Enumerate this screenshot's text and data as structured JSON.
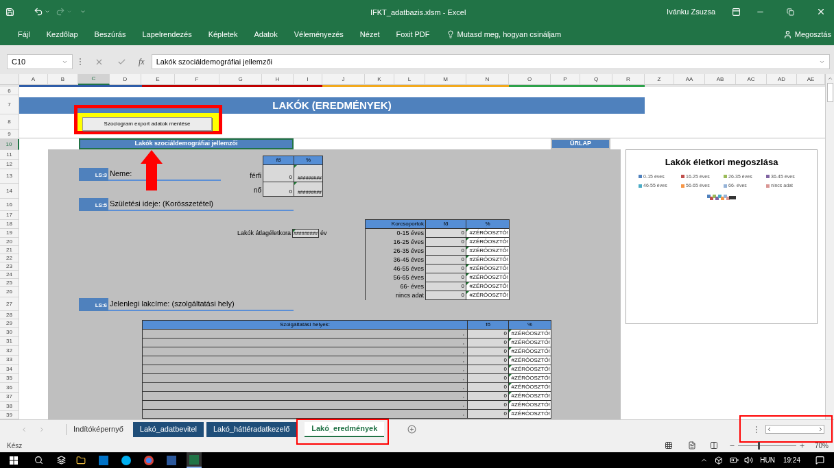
{
  "title_bar": {
    "title": "IFKT_adatbazis.xlsm - Excel",
    "user": "Ivánku Zsuzsa"
  },
  "ribbon_tabs": [
    "Fájl",
    "Kezdőlap",
    "Beszúrás",
    "Lapelrendezés",
    "Képletek",
    "Adatok",
    "Véleményezés",
    "Nézet",
    "Foxit PDF"
  ],
  "tell_me": "Mutasd meg, hogyan csináljam",
  "share": "Megosztás",
  "formula_bar": {
    "name_box": "C10",
    "fx": "fx",
    "value": "Lakók szociáldemográfiai jellemzői"
  },
  "column_headers": [
    {
      "label": "A",
      "selected": false
    },
    {
      "label": "B",
      "selected": false
    },
    {
      "label": "C",
      "selected": true
    },
    {
      "label": "D",
      "selected": false
    },
    {
      "label": "E",
      "selected": false
    },
    {
      "label": "F",
      "selected": false
    },
    {
      "label": "G",
      "selected": false
    },
    {
      "label": "H",
      "selected": false
    },
    {
      "label": "I",
      "selected": false
    },
    {
      "label": "J",
      "selected": false
    },
    {
      "label": "K",
      "selected": false
    },
    {
      "label": "L",
      "selected": false
    },
    {
      "label": "M",
      "selected": false
    },
    {
      "label": "N",
      "selected": false
    },
    {
      "label": "O",
      "selected": false
    },
    {
      "label": "P",
      "selected": false
    },
    {
      "label": "Q",
      "selected": false
    },
    {
      "label": "R",
      "selected": false
    },
    {
      "label": "Z",
      "selected": false
    },
    {
      "label": "AA",
      "selected": false
    },
    {
      "label": "AB",
      "selected": false
    },
    {
      "label": "AC",
      "selected": false
    },
    {
      "label": "AD",
      "selected": false
    },
    {
      "label": "AE",
      "selected": false
    }
  ],
  "row_headers": [
    {
      "label": "6",
      "selected": false
    },
    {
      "label": "7",
      "selected": false
    },
    {
      "label": "8",
      "selected": false
    },
    {
      "label": "9",
      "selected": false
    },
    {
      "label": "10",
      "selected": true
    },
    {
      "label": "11",
      "selected": false
    },
    {
      "label": "12",
      "selected": false
    },
    {
      "label": "13",
      "selected": false
    },
    {
      "label": "14",
      "selected": false
    },
    {
      "label": "16",
      "selected": false
    },
    {
      "label": "17",
      "selected": false
    },
    {
      "label": "18",
      "selected": false
    },
    {
      "label": "19",
      "selected": false
    },
    {
      "label": "20",
      "selected": false
    },
    {
      "label": "21",
      "selected": false
    },
    {
      "label": "22",
      "selected": false
    },
    {
      "label": "23",
      "selected": false
    },
    {
      "label": "24",
      "selected": false
    },
    {
      "label": "25",
      "selected": false
    },
    {
      "label": "26",
      "selected": false
    },
    {
      "label": "27",
      "selected": false
    },
    {
      "label": "28",
      "selected": false
    },
    {
      "label": "29",
      "selected": false
    },
    {
      "label": "30",
      "selected": false
    },
    {
      "label": "31",
      "selected": false
    },
    {
      "label": "32",
      "selected": false
    },
    {
      "label": "33",
      "selected": false
    },
    {
      "label": "34",
      "selected": false
    },
    {
      "label": "35",
      "selected": false
    },
    {
      "label": "36",
      "selected": false
    },
    {
      "label": "37",
      "selected": false
    },
    {
      "label": "38",
      "selected": false
    },
    {
      "label": "39",
      "selected": false
    }
  ],
  "sheet": {
    "title": "LAKÓK (EREDMÉNYEK)",
    "export_button": "Szociogram export adatok mentése",
    "section_header": "Lakók szociáldemográfiai jellemzői",
    "form_button": "ŰRLAP",
    "gender": {
      "code": "LS:3",
      "label": "Neme:",
      "columns": [
        "fő",
        "%"
      ],
      "rows": [
        {
          "label": "férfi",
          "count": "0",
          "percent": "#########"
        },
        {
          "label": "nő",
          "count": "0",
          "percent": "#########"
        }
      ]
    },
    "birth": {
      "code": "LS:5",
      "label": "Születési ideje: (Korösszetétel)",
      "average_label": "Lakók átlagéletkora",
      "average_value": "#########",
      "average_unit": "év",
      "columns": [
        "Korcsoportok",
        "fő",
        "%"
      ],
      "rows": [
        {
          "label": "0-15 éves",
          "count": "0",
          "percent": "#ZÉRÓOSZTÓ!"
        },
        {
          "label": "16-25 éves",
          "count": "0",
          "percent": "#ZÉRÓOSZTÓ!"
        },
        {
          "label": "26-35 éves",
          "count": "0",
          "percent": "#ZÉRÓOSZTÓ!"
        },
        {
          "label": "36-45 éves",
          "count": "0",
          "percent": "#ZÉRÓOSZTÓ!"
        },
        {
          "label": "46-55 éves",
          "count": "0",
          "percent": "#ZÉRÓOSZTÓ!"
        },
        {
          "label": "56-65 éves",
          "count": "0",
          "percent": "#ZÉRÓOSZTÓ!"
        },
        {
          "label": "66- éves",
          "count": "0",
          "percent": "#ZÉRÓOSZTÓ!"
        },
        {
          "label": "nincs adat",
          "count": "0",
          "percent": "#ZÉRÓOSZTÓ!"
        }
      ]
    },
    "address": {
      "code": "LS:6",
      "label": "Jelenlegi lakcíme: (szolgáltatási hely)",
      "columns": [
        "Szolgáltatási helyek:",
        "fő",
        "%"
      ],
      "rows": [
        {
          "place": ",",
          "count": "0",
          "percent": "#ZÉRÓOSZTÓ!"
        },
        {
          "place": ",",
          "count": "0",
          "percent": "#ZÉRÓOSZTÓ!"
        },
        {
          "place": ",",
          "count": "0",
          "percent": "#ZÉRÓOSZTÓ!"
        },
        {
          "place": ",",
          "count": "0",
          "percent": "#ZÉRÓOSZTÓ!"
        },
        {
          "place": ",",
          "count": "0",
          "percent": "#ZÉRÓOSZTÓ!"
        },
        {
          "place": ",",
          "count": "0",
          "percent": "#ZÉRÓOSZTÓ!"
        },
        {
          "place": ",",
          "count": "0",
          "percent": "#ZÉRÓOSZTÓ!"
        },
        {
          "place": ",",
          "count": "0",
          "percent": "#ZÉRÓOSZTÓ!"
        },
        {
          "place": ",",
          "count": "0",
          "percent": "#ZÉRÓOSZTÓ!"
        },
        {
          "place": ",",
          "count": "0",
          "percent": "#ZÉRÓOSZTÓ!"
        }
      ]
    }
  },
  "chart": {
    "title": "Lakók életkori megoszlása",
    "legend": [
      {
        "label": "0-15 éves",
        "color": "#4f81bd"
      },
      {
        "label": "16-25 éves",
        "color": "#c0504d"
      },
      {
        "label": "26-35 éves",
        "color": "#9bbb59"
      },
      {
        "label": "36-45 éves",
        "color": "#8064a2"
      },
      {
        "label": "46-55 éves",
        "color": "#4bacc6"
      },
      {
        "label": "56-65 éves",
        "color": "#f79646"
      },
      {
        "label": "66- éves",
        "color": "#95b3d7"
      },
      {
        "label": "nincs adat",
        "color": "#d99694"
      }
    ]
  },
  "sheet_tabs": [
    {
      "label": "Indítóképernyő",
      "selected": false
    },
    {
      "label": "Lakó_adatbevitel",
      "selected": false,
      "color": "#1f4e79"
    },
    {
      "label": "Lakó_háttéradatkezelő",
      "selected": false,
      "color": "#1f4e79"
    },
    {
      "label": "Lakó_eredmények",
      "selected": true
    }
  ],
  "status_bar": {
    "status": "Kész",
    "zoom": "70%",
    "zoom_slider": {
      "level": 0.35
    }
  },
  "taskbar": {
    "apps": [
      {
        "kind": "explorer",
        "active": false
      },
      {
        "kind": "mail",
        "active": false
      },
      {
        "kind": "skype",
        "active": false
      },
      {
        "kind": "browser",
        "active": false
      },
      {
        "kind": "word",
        "active": false
      },
      {
        "kind": "excel",
        "active": true
      }
    ],
    "language": "HUN",
    "time": "19:24"
  }
}
